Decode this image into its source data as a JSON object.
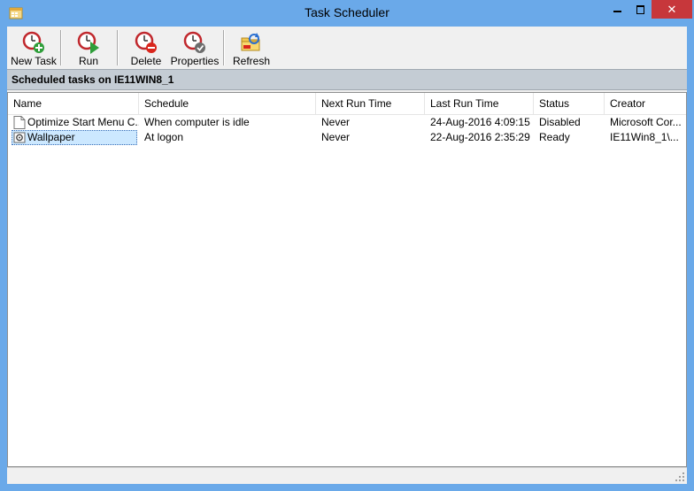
{
  "window": {
    "title": "Task Scheduler",
    "controls": {
      "minimize": "",
      "maximize": "",
      "close": "✕"
    }
  },
  "toolbar": {
    "items": [
      {
        "label": "New Task",
        "icon": "clock-add-icon"
      },
      {
        "label": "Run",
        "icon": "clock-run-icon"
      },
      {
        "label": "Delete",
        "icon": "clock-delete-icon"
      },
      {
        "label": "Properties",
        "icon": "clock-properties-icon"
      },
      {
        "label": "Refresh",
        "icon": "folder-refresh-icon"
      }
    ]
  },
  "section": {
    "title": "Scheduled tasks on IE11WIN8_1"
  },
  "table": {
    "columns": [
      "Name",
      "Schedule",
      "Next Run Time",
      "Last Run Time",
      "Status",
      "Creator"
    ],
    "rows": [
      {
        "name": "Optimize Start Menu C...",
        "schedule": "When computer is idle",
        "next": "Never",
        "last": "24-Aug-2016 4:09:15",
        "status": "Disabled",
        "creator": "Microsoft Cor...",
        "icon": "document-icon"
      },
      {
        "name": "Wallpaper",
        "schedule": "At logon",
        "next": "Never",
        "last": "22-Aug-2016 2:35:29",
        "status": "Ready",
        "creator": "IE11Win8_1\\...",
        "icon": "task-gear-icon"
      }
    ]
  },
  "colors": {
    "titlebar": "#6aa9e9",
    "close": "#c7373b",
    "selection": "#cce8ff"
  }
}
